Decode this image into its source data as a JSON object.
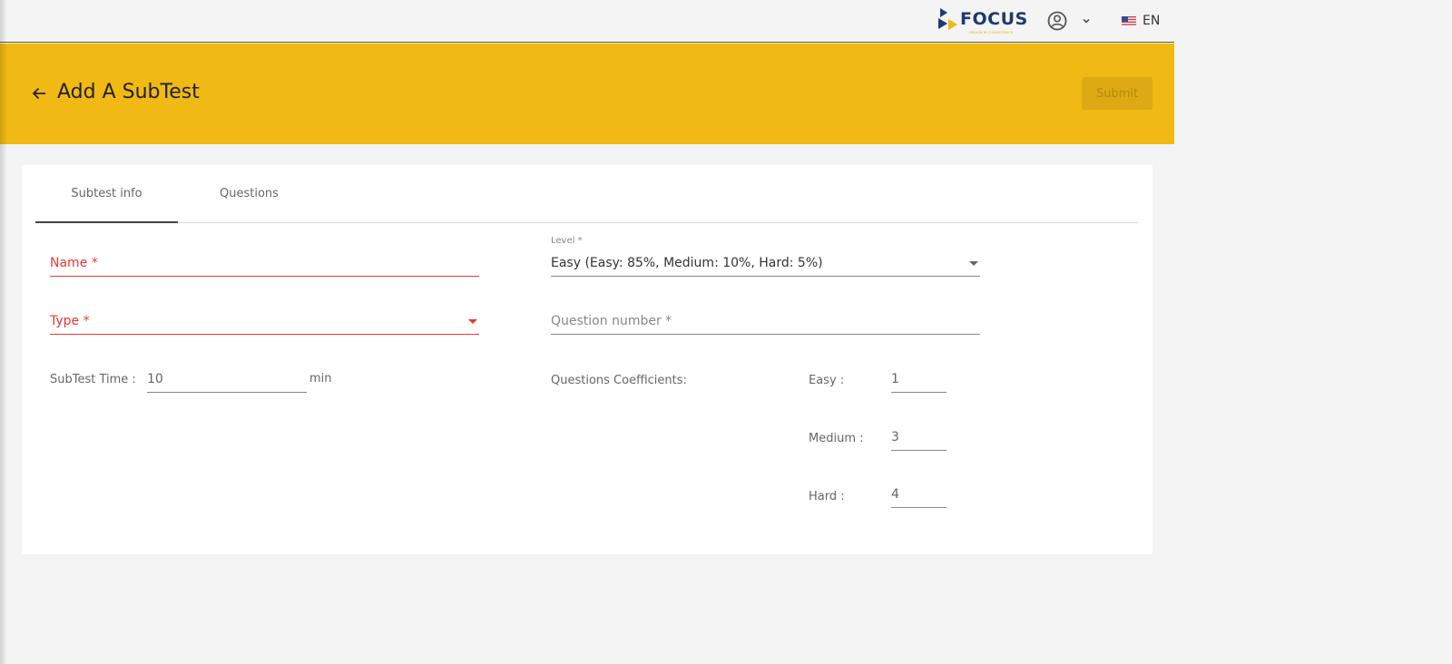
{
  "topbar": {
    "logo_text": "FOCUS",
    "logo_tagline": "DRIVEN BY COMPETENCE",
    "language": "EN",
    "icons": [
      "logo-icon",
      "user-circle-icon",
      "chevron-down-icon",
      "us-flag-icon"
    ]
  },
  "header": {
    "title": "Add A SubTest",
    "back_icon": "arrow-left-icon",
    "submit_label": "Submit",
    "background_color": "#f0b914"
  },
  "tabs": [
    {
      "label": "Subtest info",
      "active": true
    },
    {
      "label": "Questions",
      "active": false
    }
  ],
  "form": {
    "name": {
      "placeholder": "Name *",
      "value": ""
    },
    "type": {
      "placeholder": "Type *",
      "value": ""
    },
    "subtest_time": {
      "label": "SubTest Time :",
      "value": "10",
      "unit": "min"
    },
    "level": {
      "label": "Level *",
      "value": "Easy (Easy: 85%, Medium: 10%, Hard: 5%)"
    },
    "question_number": {
      "placeholder": "Question number *",
      "value": ""
    },
    "coefficients": {
      "label": "Questions Coefficients:",
      "easy": {
        "label": "Easy :",
        "value": "1"
      },
      "medium": {
        "label": "Medium :",
        "value": "3"
      },
      "hard": {
        "label": "Hard :",
        "value": "4"
      }
    }
  },
  "colors": {
    "accent": "#f0b914",
    "error": "#e53935",
    "brand_navy": "#1d3a6e"
  }
}
